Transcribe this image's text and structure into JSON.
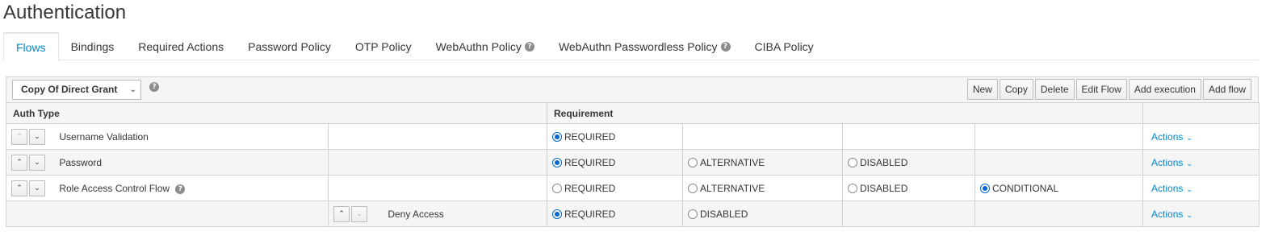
{
  "page_title": "Authentication",
  "tabs": [
    {
      "label": "Flows",
      "active": true
    },
    {
      "label": "Bindings"
    },
    {
      "label": "Required Actions"
    },
    {
      "label": "Password Policy"
    },
    {
      "label": "OTP Policy"
    },
    {
      "label": "WebAuthn Policy",
      "help": true
    },
    {
      "label": "WebAuthn Passwordless Policy",
      "help": true
    },
    {
      "label": "CIBA Policy"
    }
  ],
  "toolbar": {
    "selected_flow": "Copy Of Direct Grant",
    "buttons": [
      "New",
      "Copy",
      "Delete",
      "Edit Flow",
      "Add execution",
      "Add flow"
    ]
  },
  "table": {
    "headers": {
      "auth_type": "Auth Type",
      "requirement": "Requirement"
    },
    "rows": [
      {
        "name": "Username Validation",
        "options": [
          "REQUIRED"
        ],
        "selected": "REQUIRED",
        "actions": "Actions"
      },
      {
        "name": "Password",
        "options": [
          "REQUIRED",
          "ALTERNATIVE",
          "DISABLED"
        ],
        "selected": "REQUIRED",
        "actions": "Actions"
      },
      {
        "name": "Role Access Control Flow",
        "help": true,
        "options": [
          "REQUIRED",
          "ALTERNATIVE",
          "DISABLED",
          "CONDITIONAL"
        ],
        "selected": "CONDITIONAL",
        "actions": "Actions"
      },
      {
        "name": "Deny Access",
        "nested": true,
        "options": [
          "REQUIRED",
          "DISABLED"
        ],
        "selected": "REQUIRED",
        "actions": "Actions"
      }
    ]
  },
  "colors": {
    "accent": "#0088ce",
    "radio": "#0066cc",
    "border": "#d1d1d1",
    "header_bg": "#f5f5f5"
  }
}
